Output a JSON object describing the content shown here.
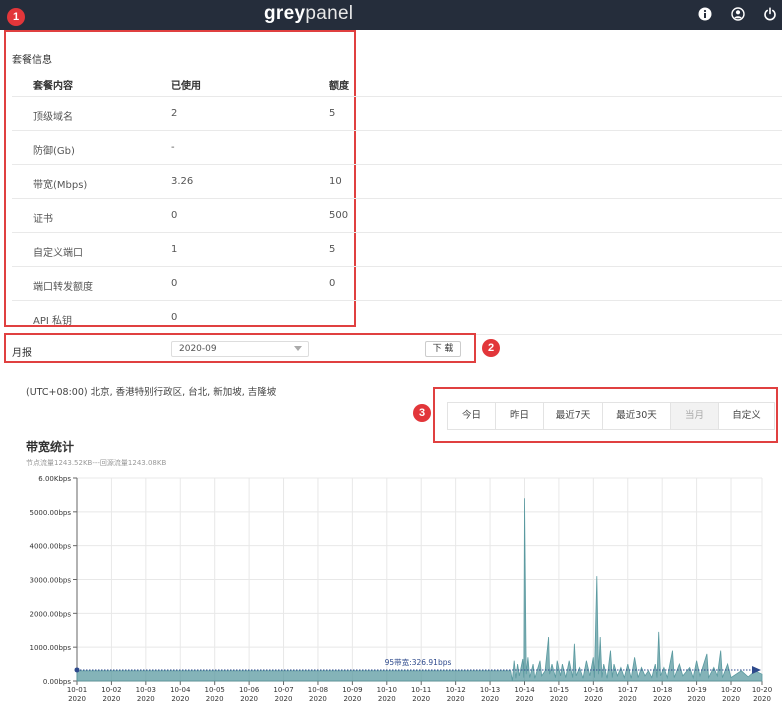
{
  "header": {
    "logo_bold": "grey",
    "logo_light": "panel",
    "icons": [
      "info-icon",
      "user-icon",
      "power-icon"
    ],
    "bg_color": "#252d3b"
  },
  "annotations": [
    "1",
    "2",
    "3"
  ],
  "package": {
    "title": "套餐信息",
    "columns": [
      "套餐内容",
      "已使用",
      "额度"
    ],
    "rows": [
      {
        "name": "顶级域名",
        "used": "2",
        "quota": "5"
      },
      {
        "name": "防御(Gb)",
        "used": "-",
        "quota": ""
      },
      {
        "name": "带宽(Mbps)",
        "used": "3.26",
        "quota": "10"
      },
      {
        "name": "证书",
        "used": "0",
        "quota": "500"
      },
      {
        "name": "自定义端口",
        "used": "1",
        "quota": "5"
      },
      {
        "name": "端口转发额度",
        "used": "0",
        "quota": "0"
      },
      {
        "name": "API 私钥",
        "used": "0",
        "quota": ""
      }
    ]
  },
  "report": {
    "label": "月报",
    "selected_month": "2020-09",
    "download_label": "下 载"
  },
  "timezone": "(UTC+08:00) 北京, 香港特别行政区, 台北, 新加坡, 吉隆坡",
  "range_tabs": [
    {
      "label": "今日",
      "active": false
    },
    {
      "label": "昨日",
      "active": false
    },
    {
      "label": "最近7天",
      "active": false
    },
    {
      "label": "最近30天",
      "active": false
    },
    {
      "label": "当月",
      "active": true
    },
    {
      "label": "自定义",
      "active": false
    }
  ],
  "chart_title": "带宽统计",
  "chart_subtitle": "节点流量1243.52KB---回源流量1243.08KB",
  "chart_data": {
    "type": "area",
    "title": "带宽统计",
    "subtitle": "节点流量1243.52KB---回源流量1243.08KB",
    "y_ticks": [
      "0.00bps",
      "1000.00bps",
      "2000.00bps",
      "3000.00bps",
      "4000.00bps",
      "5000.00bps",
      "6.00Kbps"
    ],
    "ylim": [
      0,
      6000
    ],
    "x_ticks": [
      "10-01",
      "10-02",
      "10-03",
      "10-04",
      "10-05",
      "10-06",
      "10-07",
      "10-08",
      "10-09",
      "10-10",
      "10-11",
      "10-12",
      "10-13",
      "10-14",
      "10-15",
      "10-16",
      "10-17",
      "10-18",
      "10-19",
      "10-20",
      "10-20"
    ],
    "x_tick_year": "2020",
    "xlim_days": [
      1,
      20.9
    ],
    "grid": true,
    "color": "#5b9aa0",
    "p95_label": "95带宽:326.91bps",
    "p95_value": 326.91,
    "series": [
      {
        "points": [
          [
            1.0,
            300
          ],
          [
            13.6,
            300
          ],
          [
            13.65,
            0
          ],
          [
            13.7,
            600
          ],
          [
            13.75,
            80
          ],
          [
            13.8,
            500
          ],
          [
            13.85,
            150
          ],
          [
            13.95,
            650
          ],
          [
            13.98,
            100
          ],
          [
            14.0,
            5400
          ],
          [
            14.05,
            200
          ],
          [
            14.1,
            700
          ],
          [
            14.15,
            100
          ],
          [
            14.25,
            500
          ],
          [
            14.3,
            80
          ],
          [
            14.45,
            600
          ],
          [
            14.5,
            150
          ],
          [
            14.6,
            300
          ],
          [
            14.7,
            1300
          ],
          [
            14.73,
            200
          ],
          [
            14.8,
            500
          ],
          [
            14.9,
            100
          ],
          [
            14.95,
            600
          ],
          [
            15.05,
            150
          ],
          [
            15.1,
            500
          ],
          [
            15.2,
            100
          ],
          [
            15.3,
            600
          ],
          [
            15.4,
            100
          ],
          [
            15.45,
            1100
          ],
          [
            15.5,
            150
          ],
          [
            15.6,
            400
          ],
          [
            15.7,
            80
          ],
          [
            15.8,
            600
          ],
          [
            15.9,
            150
          ],
          [
            16.0,
            700
          ],
          [
            16.03,
            100
          ],
          [
            16.1,
            3100
          ],
          [
            16.15,
            200
          ],
          [
            16.2,
            1300
          ],
          [
            16.25,
            100
          ],
          [
            16.3,
            500
          ],
          [
            16.4,
            80
          ],
          [
            16.5,
            900
          ],
          [
            16.55,
            100
          ],
          [
            16.6,
            500
          ],
          [
            16.7,
            150
          ],
          [
            16.8,
            400
          ],
          [
            16.9,
            100
          ],
          [
            17.0,
            500
          ],
          [
            17.1,
            80
          ],
          [
            17.2,
            700
          ],
          [
            17.3,
            100
          ],
          [
            17.4,
            400
          ],
          [
            17.5,
            150
          ],
          [
            17.6,
            300
          ],
          [
            17.7,
            100
          ],
          [
            17.8,
            500
          ],
          [
            17.85,
            100
          ],
          [
            17.9,
            1450
          ],
          [
            17.95,
            150
          ],
          [
            18.05,
            400
          ],
          [
            18.15,
            100
          ],
          [
            18.3,
            900
          ],
          [
            18.35,
            100
          ],
          [
            18.5,
            500
          ],
          [
            18.6,
            150
          ],
          [
            18.8,
            400
          ],
          [
            18.9,
            100
          ],
          [
            19.0,
            600
          ],
          [
            19.1,
            150
          ],
          [
            19.3,
            800
          ],
          [
            19.35,
            100
          ],
          [
            19.5,
            400
          ],
          [
            19.6,
            150
          ],
          [
            19.7,
            900
          ],
          [
            19.75,
            100
          ],
          [
            19.9,
            500
          ],
          [
            20.0,
            100
          ],
          [
            20.3,
            300
          ],
          [
            20.5,
            120
          ],
          [
            20.7,
            300
          ],
          [
            20.9,
            200
          ]
        ]
      }
    ]
  }
}
